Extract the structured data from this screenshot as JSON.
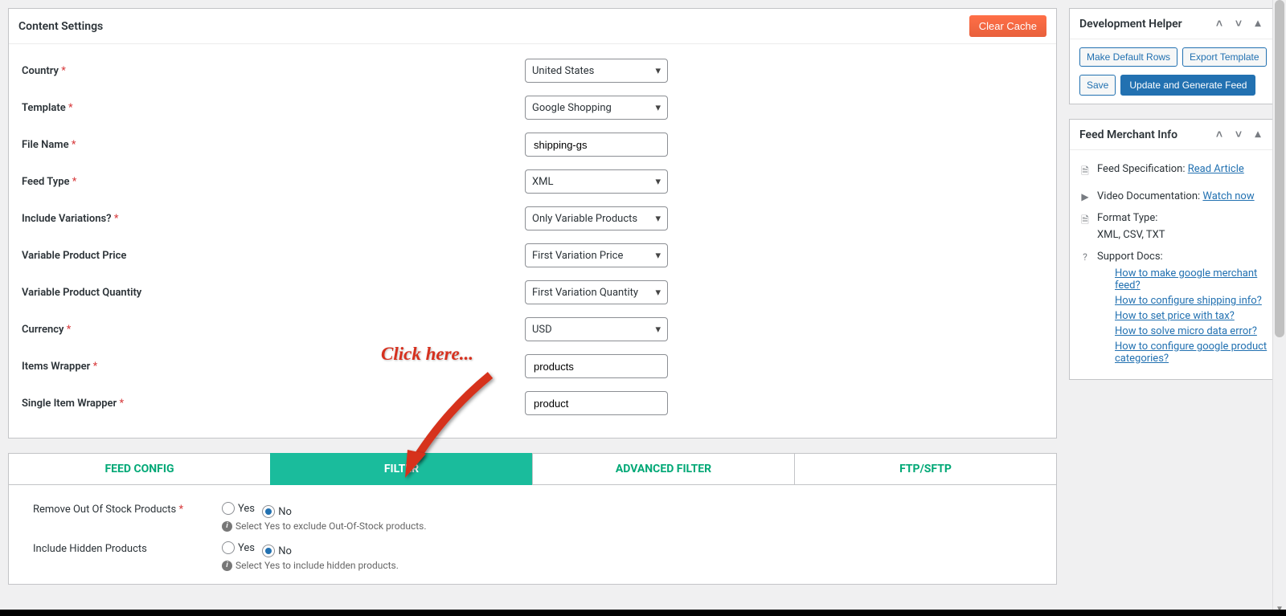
{
  "settings": {
    "title": "Content Settings",
    "clear_cache": "Clear Cache",
    "rows": {
      "country": {
        "label": "Country",
        "value": "United States"
      },
      "template": {
        "label": "Template",
        "value": "Google Shopping"
      },
      "file_name": {
        "label": "File Name",
        "value": "shipping-gs"
      },
      "feed_type": {
        "label": "Feed Type",
        "value": "XML"
      },
      "include_variations": {
        "label": "Include Variations?",
        "value": "Only Variable Products"
      },
      "variable_price": {
        "label": "Variable Product Price",
        "value": "First Variation Price"
      },
      "variable_qty": {
        "label": "Variable Product Quantity",
        "value": "First Variation Quantity"
      },
      "currency": {
        "label": "Currency",
        "value": "USD"
      },
      "items_wrapper": {
        "label": "Items Wrapper",
        "value": "products"
      },
      "single_item_wrapper": {
        "label": "Single Item Wrapper",
        "value": "product"
      }
    }
  },
  "tabs": {
    "feed_config": "FEED CONFIG",
    "filter": "FILTER",
    "advanced_filter": "ADVANCED FILTER",
    "ftp": "FTP/SFTP"
  },
  "filter": {
    "remove_oos": {
      "label": "Remove Out Of Stock Products",
      "yes": "Yes",
      "no": "No",
      "hint": "Select Yes to exclude Out-Of-Stock products."
    },
    "include_hidden": {
      "label": "Include Hidden Products",
      "yes": "Yes",
      "no": "No",
      "hint": "Select Yes to include hidden products."
    }
  },
  "sidebar": {
    "dev_helper": {
      "title": "Development Helper",
      "make_default": "Make Default Rows",
      "export_template": "Export Template",
      "save": "Save",
      "update_generate": "Update and Generate Feed"
    },
    "merchant_info": {
      "title": "Feed Merchant Info",
      "spec_label": "Feed Specification:",
      "spec_link": "Read Article",
      "video_label": "Video Documentation:",
      "video_link": "Watch now",
      "format_label": "Format Type:",
      "format_value": "XML, CSV, TXT",
      "support_label": "Support Docs:",
      "links": {
        "l1": "How to make google merchant feed?",
        "l2": "How to configure shipping info?",
        "l3": "How to set price with tax?",
        "l4": "How to solve micro data error?",
        "l5": "How to configure google product categories?"
      }
    }
  },
  "overlay": {
    "click_here": "Click here..."
  }
}
